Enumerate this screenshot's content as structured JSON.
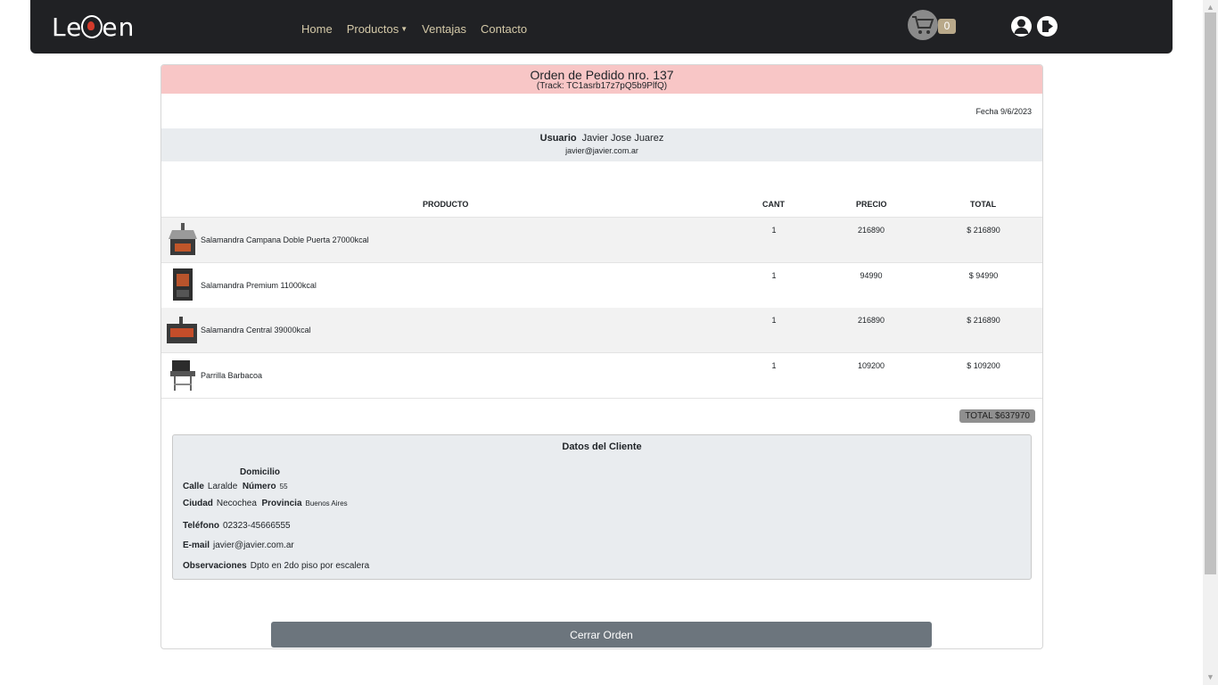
{
  "navbar": {
    "brand": "LePen",
    "links": [
      "Home",
      "Productos",
      "Ventajas",
      "Contacto"
    ],
    "cart_count": "0"
  },
  "order": {
    "title": "Orden de Pedido nro. 137",
    "track": "(Track: TC1asrb17z7pQ5b9PlfQ)",
    "date": "Fecha 9/6/2023",
    "user_label": "Usuario",
    "user_name": "Javier Jose Juarez",
    "user_email": "javier@javier.com.ar"
  },
  "table": {
    "headers": {
      "product": "PRODUCTO",
      "qty": "CANT",
      "price": "PRECIO",
      "total": "TOTAL"
    },
    "rows": [
      {
        "name": "Salamandra Campana Doble Puerta 27000kcal",
        "qty": "1",
        "price": "216890",
        "total": "$ 216890"
      },
      {
        "name": "Salamandra Premium 11000kcal",
        "qty": "1",
        "price": "94990",
        "total": "$ 94990"
      },
      {
        "name": "Salamandra Central 39000kcal",
        "qty": "1",
        "price": "216890",
        "total": "$ 216890"
      },
      {
        "name": "Parrilla Barbacoa",
        "qty": "1",
        "price": "109200",
        "total": "$ 109200"
      }
    ],
    "grand_total": "TOTAL $637970"
  },
  "client": {
    "title": "Datos del Cliente",
    "domicilio_label": "Domicilio",
    "calle_label": "Calle",
    "calle": "Laralde",
    "numero_label": "Número",
    "numero": "55",
    "ciudad_label": "Ciudad",
    "ciudad": "Necochea",
    "provincia_label": "Provincia",
    "provincia": "Buenos Aires",
    "telefono_label": "Teléfono",
    "telefono": "02323-45666555",
    "email_label": "E-mail",
    "email": "javier@javier.com.ar",
    "obs_label": "Observaciones",
    "obs": "Dpto en 2do piso por escalera"
  },
  "actions": {
    "close": "Cerrar Orden"
  },
  "colors": {
    "navbar": "#202124",
    "header_bg": "#f8c6c6",
    "band": "#e9ecef",
    "button": "#6c757d"
  }
}
